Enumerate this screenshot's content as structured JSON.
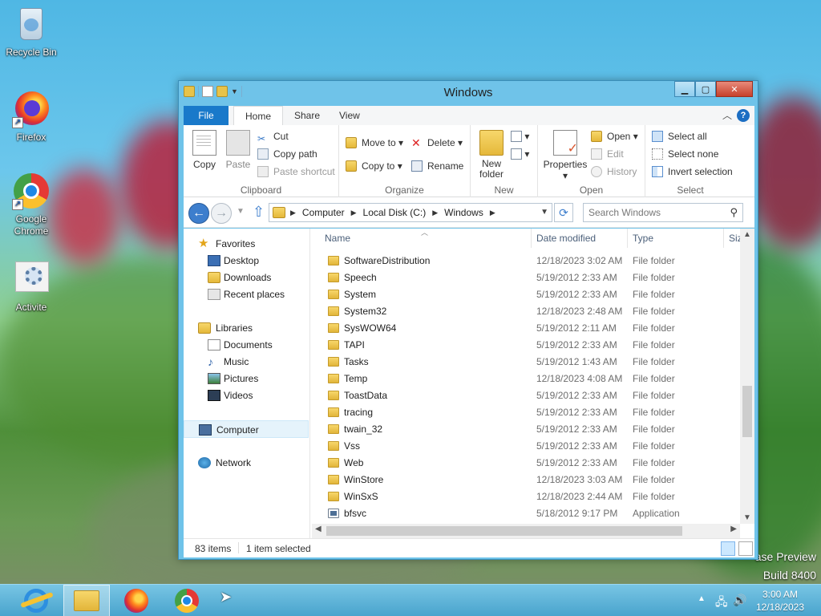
{
  "desktop": {
    "icons": [
      {
        "label": "Recycle Bin"
      },
      {
        "label": "Firefox"
      },
      {
        "label": "Google Chrome"
      },
      {
        "label": "Activite"
      }
    ],
    "watermark_line1": "ase Preview",
    "watermark_line2": "Build 8400"
  },
  "window": {
    "title": "Windows",
    "controls": {
      "minimize": "▁",
      "maximize": "▢",
      "close": "✕"
    }
  },
  "ribbon": {
    "tabs": [
      {
        "label": "File"
      },
      {
        "label": "Home"
      },
      {
        "label": "Share"
      },
      {
        "label": "View"
      }
    ],
    "help": "?",
    "collapse": "︿",
    "groups": {
      "clipboard": {
        "label": "Clipboard",
        "copy": "Copy",
        "paste": "Paste",
        "cut": "Cut",
        "copy_path": "Copy path",
        "paste_shortcut": "Paste shortcut"
      },
      "organize": {
        "label": "Organize",
        "move_to": "Move to",
        "copy_to": "Copy to",
        "delete": "Delete",
        "rename": "Rename"
      },
      "new": {
        "label": "New",
        "new_folder_line1": "New",
        "new_folder_line2": "folder"
      },
      "open": {
        "label": "Open",
        "properties": "Properties",
        "open": "Open",
        "edit": "Edit",
        "history": "History"
      },
      "select": {
        "label": "Select",
        "select_all": "Select all",
        "select_none": "Select none",
        "invert_selection": "Invert selection"
      }
    }
  },
  "address": {
    "crumbs": [
      "Computer",
      "Local Disk (C:)",
      "Windows"
    ],
    "search_placeholder": "Search Windows"
  },
  "navpane": {
    "favorites": "Favorites",
    "desktop": "Desktop",
    "downloads": "Downloads",
    "recent_places": "Recent places",
    "libraries": "Libraries",
    "documents": "Documents",
    "music": "Music",
    "pictures": "Pictures",
    "videos": "Videos",
    "computer": "Computer",
    "network": "Network"
  },
  "filelist": {
    "columns": [
      "Name",
      "Date modified",
      "Type",
      "Size"
    ],
    "rows": [
      {
        "name": "SoftwareDistribution",
        "date": "12/18/2023 3:02 AM",
        "type": "File folder",
        "kind": "folder"
      },
      {
        "name": "Speech",
        "date": "5/19/2012 2:33 AM",
        "type": "File folder",
        "kind": "folder"
      },
      {
        "name": "System",
        "date": "5/19/2012 2:33 AM",
        "type": "File folder",
        "kind": "folder"
      },
      {
        "name": "System32",
        "date": "12/18/2023 2:48 AM",
        "type": "File folder",
        "kind": "folder"
      },
      {
        "name": "SysWOW64",
        "date": "5/19/2012 2:11 AM",
        "type": "File folder",
        "kind": "folder"
      },
      {
        "name": "TAPI",
        "date": "5/19/2012 2:33 AM",
        "type": "File folder",
        "kind": "folder"
      },
      {
        "name": "Tasks",
        "date": "5/19/2012 1:43 AM",
        "type": "File folder",
        "kind": "folder"
      },
      {
        "name": "Temp",
        "date": "12/18/2023 4:08 AM",
        "type": "File folder",
        "kind": "folder"
      },
      {
        "name": "ToastData",
        "date": "5/19/2012 2:33 AM",
        "type": "File folder",
        "kind": "folder"
      },
      {
        "name": "tracing",
        "date": "5/19/2012 2:33 AM",
        "type": "File folder",
        "kind": "folder"
      },
      {
        "name": "twain_32",
        "date": "5/19/2012 2:33 AM",
        "type": "File folder",
        "kind": "folder"
      },
      {
        "name": "Vss",
        "date": "5/19/2012 2:33 AM",
        "type": "File folder",
        "kind": "folder"
      },
      {
        "name": "Web",
        "date": "5/19/2012 2:33 AM",
        "type": "File folder",
        "kind": "folder"
      },
      {
        "name": "WinStore",
        "date": "12/18/2023 3:03 AM",
        "type": "File folder",
        "kind": "folder"
      },
      {
        "name": "WinSxS",
        "date": "12/18/2023 2:44 AM",
        "type": "File folder",
        "kind": "folder"
      },
      {
        "name": "bfsvc",
        "date": "5/18/2012 9:17 PM",
        "type": "Application",
        "kind": "app"
      }
    ]
  },
  "status": {
    "item_count": "83 items",
    "selection": "1 item selected"
  },
  "taskbar": {
    "time": "3:00 AM",
    "date": "12/18/2023"
  }
}
